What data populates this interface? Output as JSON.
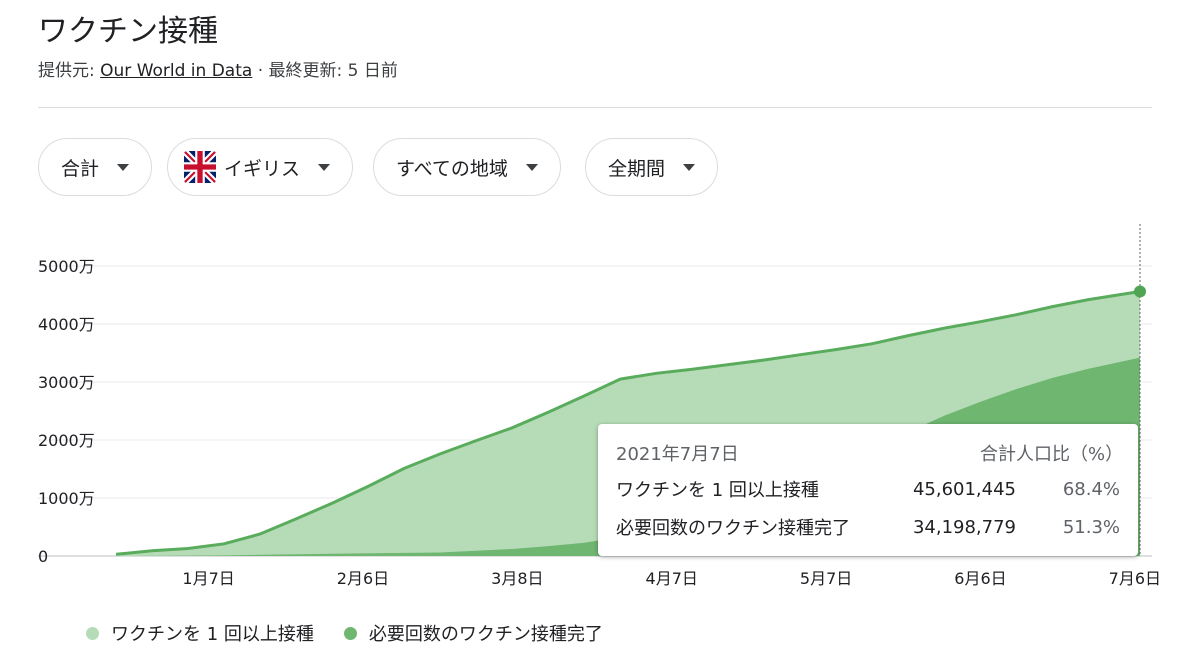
{
  "header": {
    "title": "ワクチン接種",
    "source_prefix": "提供元: ",
    "source_link": "Our World in Data",
    "updated": " · 最終更新: 5 日前"
  },
  "filters": [
    {
      "label": "合計"
    },
    {
      "label": "イギリス",
      "icon": "uk-flag-icon"
    },
    {
      "label": "すべての地域"
    },
    {
      "label": "全期間"
    }
  ],
  "tooltip": {
    "date": "2021年7月7日",
    "col_total": "合計",
    "col_ratio": "人口比（%）",
    "rows": [
      {
        "name": "ワクチンを 1 回以上接種",
        "total": "45,601,445",
        "ratio": "68.4%"
      },
      {
        "name": "必要回数のワクチン接種完了",
        "total": "34,198,779",
        "ratio": "51.3%"
      }
    ]
  },
  "colors": {
    "light_fill": "#b6dcb7",
    "light_line": "#5aac5d",
    "dark_fill": "#6fb671",
    "marker": "#4fa553"
  },
  "chart_data": {
    "type": "area",
    "y_ticks": [
      {
        "value": 0,
        "label": "0"
      },
      {
        "value": 10000000,
        "label": "1000万"
      },
      {
        "value": 20000000,
        "label": "2000万"
      },
      {
        "value": 30000000,
        "label": "3000万"
      },
      {
        "value": 40000000,
        "label": "4000万"
      },
      {
        "value": 50000000,
        "label": "5000万"
      }
    ],
    "x_ticks": [
      {
        "date": "2021-01-07",
        "label": "1月7日"
      },
      {
        "date": "2021-02-06",
        "label": "2月6日"
      },
      {
        "date": "2021-03-08",
        "label": "3月8日"
      },
      {
        "date": "2021-04-07",
        "label": "4月7日"
      },
      {
        "date": "2021-05-07",
        "label": "5月7日"
      },
      {
        "date": "2021-06-06",
        "label": "6月6日"
      },
      {
        "date": "2021-07-06",
        "label": "7月6日"
      }
    ],
    "ylim": [
      0,
      50000000
    ],
    "xlim": [
      "2020-12-20",
      "2021-07-07"
    ],
    "grid": true,
    "legend_position": "bottom-left",
    "series": [
      {
        "name": "ワクチンを 1 回以上接種",
        "x": [
          "2020-12-20",
          "2020-12-27",
          "2021-01-03",
          "2021-01-10",
          "2021-01-17",
          "2021-01-24",
          "2021-01-31",
          "2021-02-07",
          "2021-02-14",
          "2021-02-21",
          "2021-02-28",
          "2021-03-07",
          "2021-03-14",
          "2021-03-21",
          "2021-03-28",
          "2021-04-04",
          "2021-04-11",
          "2021-04-18",
          "2021-04-25",
          "2021-05-02",
          "2021-05-09",
          "2021-05-16",
          "2021-05-23",
          "2021-05-30",
          "2021-06-06",
          "2021-06-13",
          "2021-06-20",
          "2021-06-27",
          "2021-07-07"
        ],
        "y": [
          300000,
          900000,
          1300000,
          2100000,
          3800000,
          6400000,
          9100000,
          12000000,
          15100000,
          17600000,
          19900000,
          22100000,
          24800000,
          27600000,
          30500000,
          31500000,
          32200000,
          33000000,
          33800000,
          34700000,
          35600000,
          36600000,
          38000000,
          39300000,
          40400000,
          41600000,
          43000000,
          44200000,
          45601445
        ]
      },
      {
        "name": "必要回数のワクチン接種完了",
        "x": [
          "2020-12-20",
          "2021-01-10",
          "2021-01-31",
          "2021-02-21",
          "2021-03-07",
          "2021-03-14",
          "2021-03-21",
          "2021-03-28",
          "2021-04-04",
          "2021-04-11",
          "2021-04-18",
          "2021-04-25",
          "2021-05-02",
          "2021-05-09",
          "2021-05-16",
          "2021-05-23",
          "2021-05-30",
          "2021-06-06",
          "2021-06-13",
          "2021-06-20",
          "2021-06-27",
          "2021-07-07"
        ],
        "y": [
          0,
          100000,
          400000,
          600000,
          1200000,
          1700000,
          2300000,
          3300000,
          4900000,
          6800000,
          9100000,
          11500000,
          13900000,
          16300000,
          18700000,
          21400000,
          24200000,
          26600000,
          28800000,
          30700000,
          32300000,
          34198779
        ]
      }
    ]
  }
}
